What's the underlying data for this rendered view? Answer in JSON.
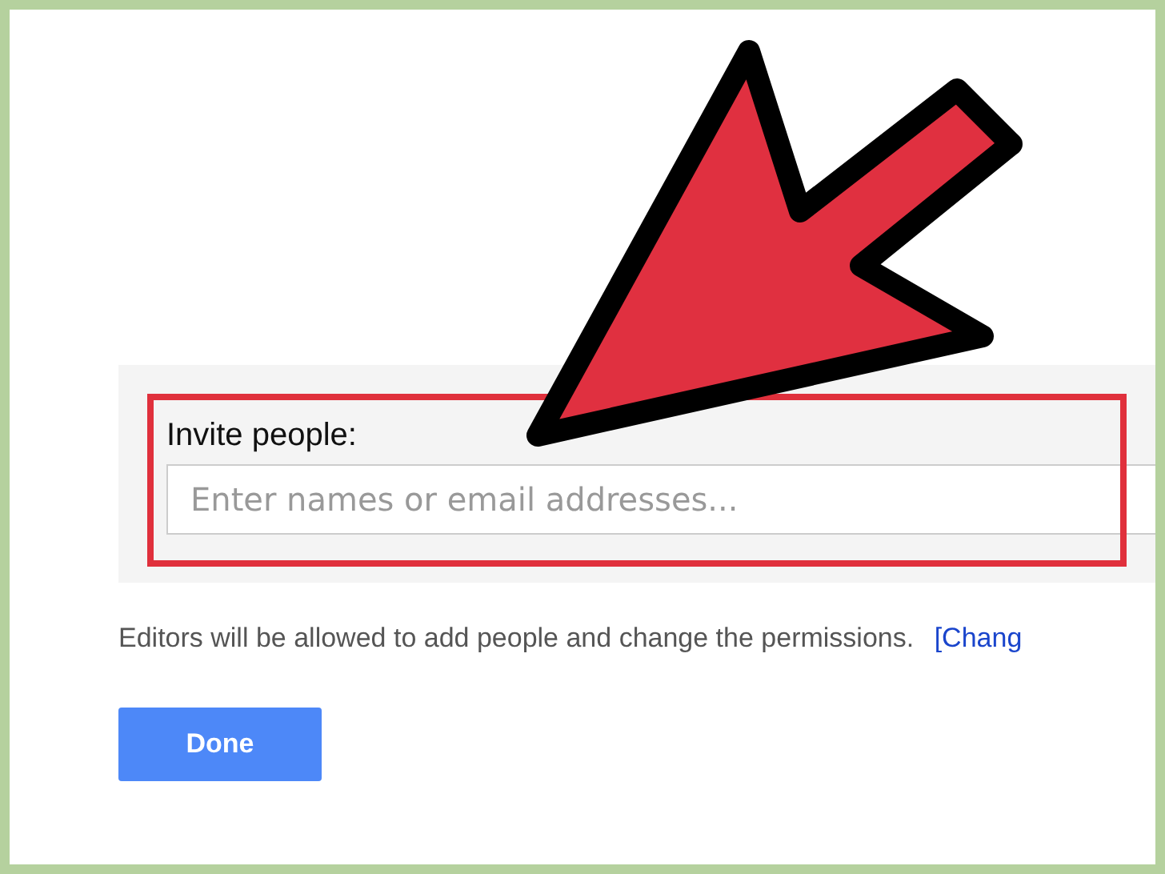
{
  "invite": {
    "label": "Invite people:",
    "placeholder": "Enter names or email addresses..."
  },
  "notice": {
    "text": "Editors will be allowed to add people and change the permissions.",
    "link": "[Chang"
  },
  "buttons": [
    "Done"
  ]
}
